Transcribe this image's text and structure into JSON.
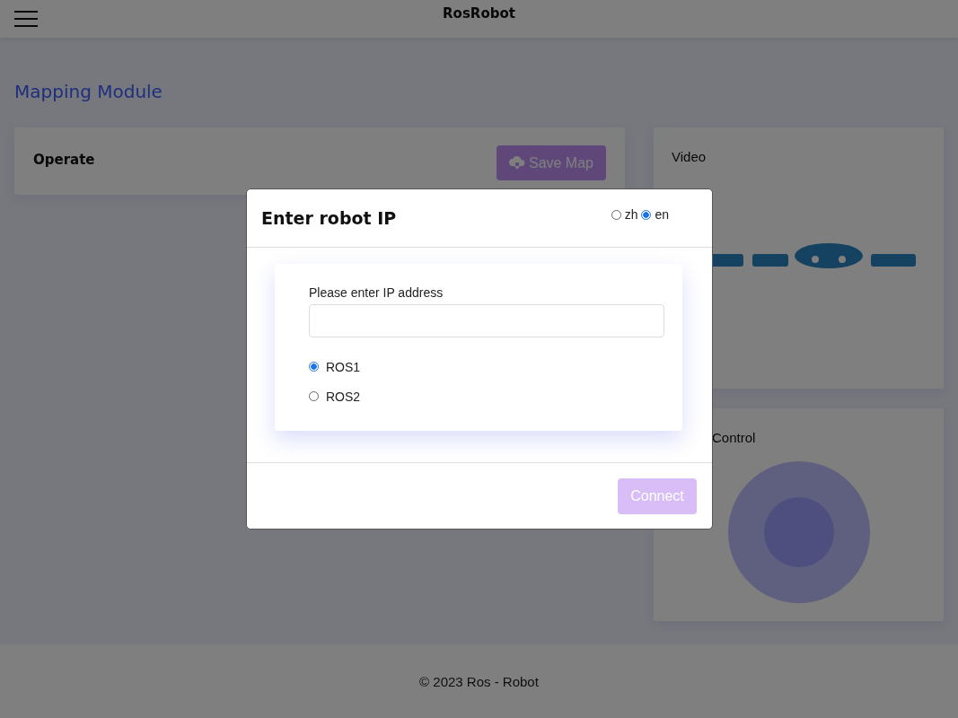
{
  "header": {
    "title": "RosRobot"
  },
  "page_title": "Mapping Module",
  "operate_card": {
    "title": "Operate",
    "save_button": {
      "label": "Save Map",
      "disabled": true
    }
  },
  "video_card": {
    "title": "Video"
  },
  "control_card": {
    "title": "Control"
  },
  "footer": {
    "text": "© 2023 Ros - Robot"
  },
  "dialog": {
    "title": "Enter robot IP",
    "languages": [
      {
        "label": "zh",
        "selected": false
      },
      {
        "label": "en",
        "selected": true
      }
    ],
    "ip_field": {
      "label": "Please enter IP address"
    },
    "ros_versions": [
      {
        "label": "ROS1",
        "selected": true
      },
      {
        "label": "ROS2",
        "selected": false
      }
    ],
    "connect_button": {
      "label": "Connect",
      "disabled": true
    }
  }
}
